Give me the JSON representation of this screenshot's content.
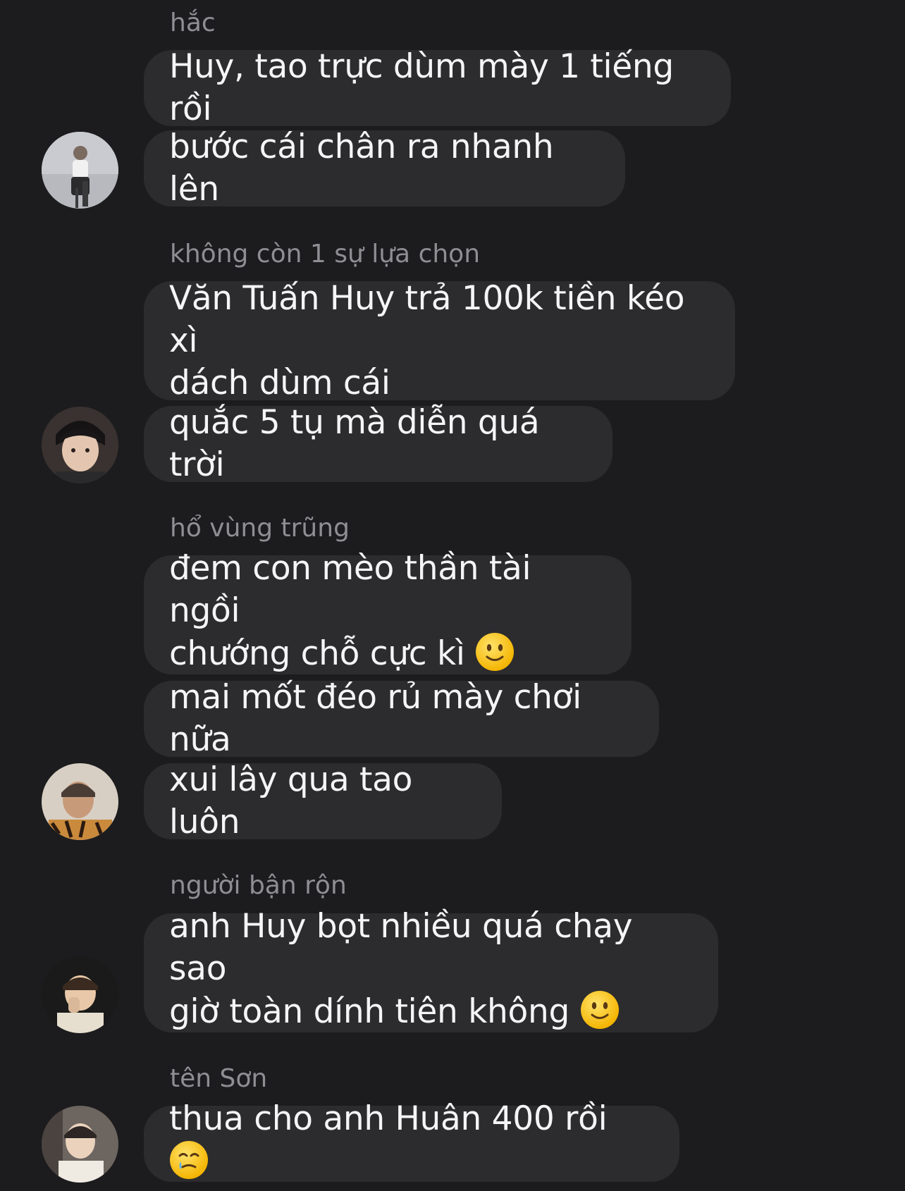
{
  "messages": [
    {
      "sender": "hắc",
      "bubbles": [
        "Huy, tao trực dùm mày 1 tiếng rồi",
        "bước cái chân ra nhanh lên"
      ]
    },
    {
      "sender": "không còn 1 sự lựa chọn",
      "bubbles": [
        "Văn Tuấn Huy trả 100k tiền kéo xì\ndách dùm cái",
        "quắc 5 tụ mà diễn quá trời"
      ]
    },
    {
      "sender": "hổ vùng trũng",
      "bubbles": [
        "đem con mèo thần tài ngồi\nchướng chỗ cực kì",
        "mai mốt đéo rủ mày chơi nữa",
        "xui lây qua tao luôn"
      ]
    },
    {
      "sender": "người bận rộn",
      "bubbles": [
        "anh Huy bọt nhiều quá chạy sao\ngiờ toàn dính tiên không"
      ]
    },
    {
      "sender": "tên Sơn",
      "bubbles": [
        "thua cho anh Huân 400 rồi"
      ]
    }
  ],
  "icons": {
    "slight_smile": "slightly-smiling-face-emoji",
    "tear_smile": "smiling-face-with-tear-emoji"
  },
  "colors": {
    "background": "#1c1c1e",
    "bubble": "#2c2c2e",
    "sender_text": "#8e8e93",
    "message_text": "#f5f5f7"
  }
}
